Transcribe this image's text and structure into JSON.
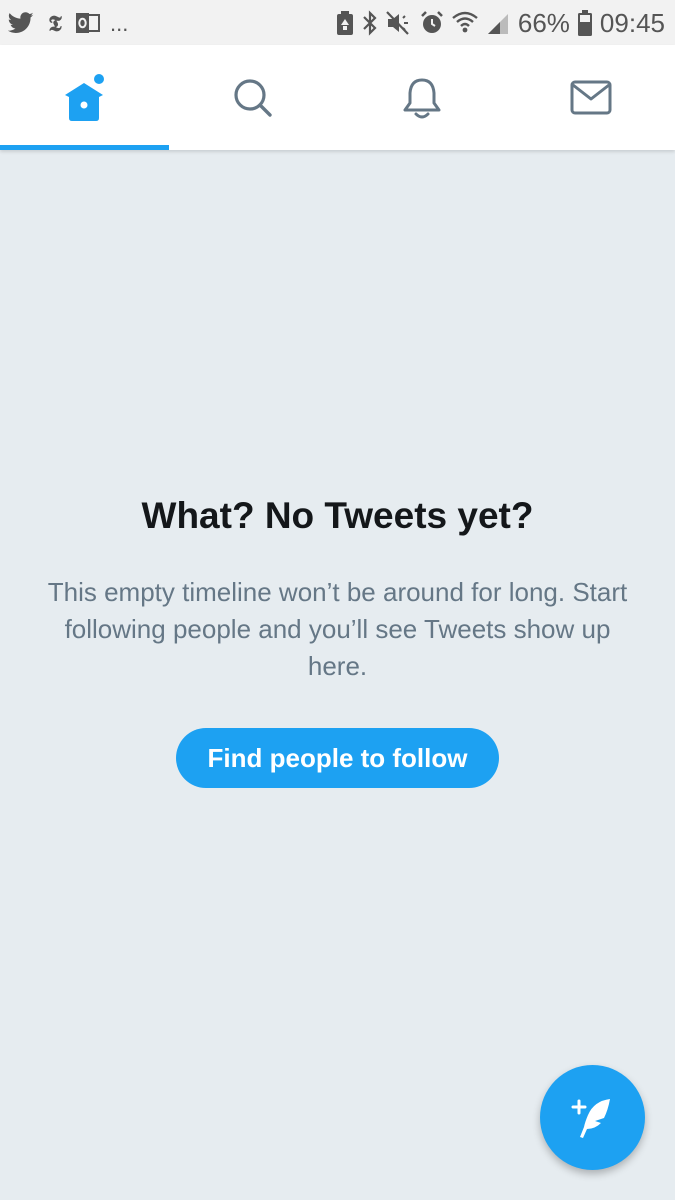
{
  "status_bar": {
    "left_icons": [
      "twitter-bird-icon",
      "nyt-icon",
      "outlook-icon"
    ],
    "overflow": "...",
    "right_icons": [
      "battery-saver-icon",
      "bluetooth-icon",
      "mute-icon",
      "alarm-icon",
      "wifi-icon",
      "signal-icon",
      "battery-icon"
    ],
    "battery_percent": "66%",
    "time": "09:45"
  },
  "nav": {
    "tabs": [
      {
        "id": "home",
        "icon": "home-icon",
        "active": true
      },
      {
        "id": "search",
        "icon": "search-icon",
        "active": false
      },
      {
        "id": "notifications",
        "icon": "bell-icon",
        "active": false
      },
      {
        "id": "messages",
        "icon": "mail-icon",
        "active": false
      }
    ],
    "accent_color": "#1da1f2",
    "inactive_color": "#657786"
  },
  "empty_state": {
    "title": "What? No Tweets yet?",
    "body": "This empty timeline won’t be around for long. Start following people and you’ll see Tweets show up here.",
    "button_label": "Find people to follow"
  },
  "fab": {
    "icon": "compose-tweet-icon",
    "color": "#1da1f2"
  }
}
